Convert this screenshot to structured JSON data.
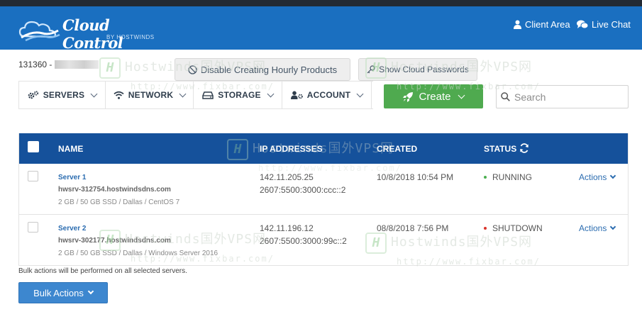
{
  "header": {
    "brand": "Cloud Control",
    "brand_sub": "BY HOSTWINDS",
    "client_area": "Client Area",
    "live_chat": "Live Chat"
  },
  "account": {
    "id_prefix": "131360 -"
  },
  "toolbar": {
    "disable_hourly": "Disable Creating Hourly Products",
    "show_passwords": "Show Cloud Passwords"
  },
  "nav": {
    "items": [
      {
        "label": "SERVERS",
        "icon": "gears-icon"
      },
      {
        "label": "NETWORK",
        "icon": "wifi-icon"
      },
      {
        "label": "STORAGE",
        "icon": "drive-icon"
      },
      {
        "label": "ACCOUNT",
        "icon": "user-gear-icon"
      }
    ],
    "create_label": "Create"
  },
  "search": {
    "placeholder": "Search"
  },
  "table": {
    "headers": {
      "name": "NAME",
      "ip": "IP ADDRESSES",
      "created": "CREATED",
      "status": "STATUS"
    },
    "rows": [
      {
        "name": "Server 1",
        "hostname": "hwsrv-312754.hostwindsdns.com",
        "spec": "2 GB / 50 GB SSD / Dallas / CentOS 7",
        "ipv4": "142.11.205.25",
        "ipv6": "2607:5500:3000:ccc::2",
        "created": "10/8/2018 10:54 PM",
        "status": "RUNNING",
        "status_color": "#4caf50",
        "actions": "Actions"
      },
      {
        "name": "Server 2",
        "hostname": "hwsrv-302177.hostwindsdns.com",
        "spec": "2 GB / 50 GB SSD / Dallas / Windows Server 2016",
        "ipv4": "142.11.196.12",
        "ipv6": "2607:5500:3000:99c::2",
        "created": "08/8/2018 7:56 PM",
        "status": "SHUTDOWN",
        "status_color": "#d9342b",
        "actions": "Actions"
      }
    ]
  },
  "bulk": {
    "note": "Bulk actions will be performed on all selected servers.",
    "button": "Bulk Actions"
  },
  "watermark": {
    "text": "Hostwinds国外VPS网",
    "url": "http://www.fixbar.com/",
    "badge": "H"
  },
  "colors": {
    "header_bg": "#1a6fc0",
    "table_header_bg": "#15519b",
    "create_bg": "#4faa4f",
    "bulk_bg": "#3d87cf",
    "link": "#2b6cb0"
  }
}
